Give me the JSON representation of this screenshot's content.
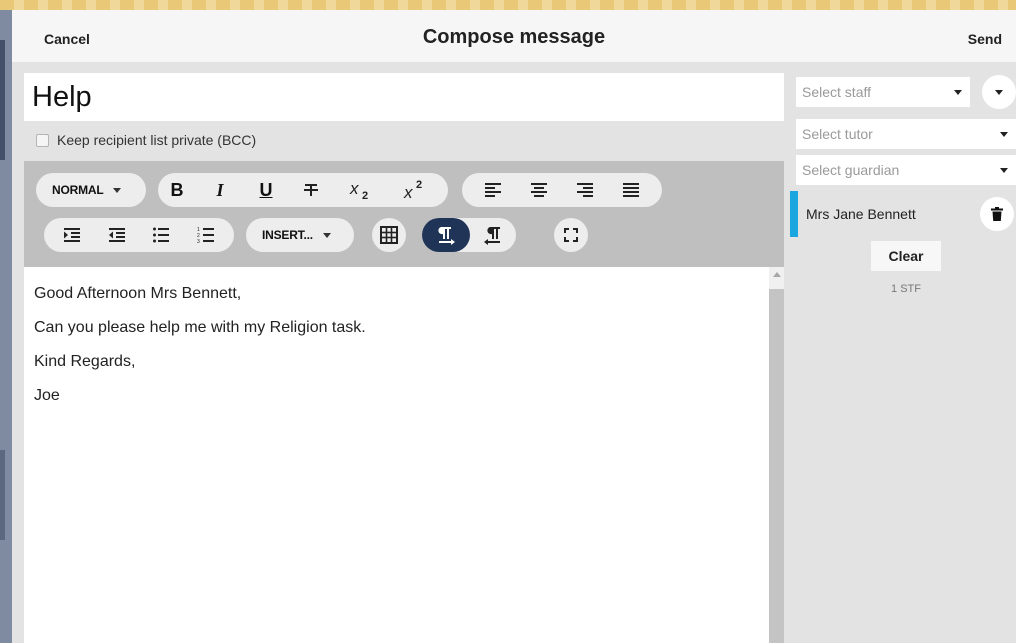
{
  "header": {
    "cancel_label": "Cancel",
    "title": "Compose message",
    "send_label": "Send"
  },
  "subject": {
    "value": "Help"
  },
  "bcc": {
    "label": "Keep recipient list private (BCC)",
    "checked": false
  },
  "toolbar": {
    "format_dropdown": "NORMAL",
    "insert_dropdown": "INSERT...",
    "buttons": {
      "bold": "B",
      "italic": "I",
      "underline": "U",
      "strikethrough": "strikethrough-icon",
      "subscript": "subscript-icon",
      "superscript": "superscript-icon",
      "align_left": "align-left-icon",
      "align_center": "align-center-icon",
      "align_right": "align-right-icon",
      "align_justify": "align-justify-icon",
      "indent": "indent-icon",
      "outdent": "outdent-icon",
      "bullet_list": "bullet-list-icon",
      "numbered_list": "numbered-list-icon",
      "table": "table-icon",
      "ltr": "ltr-paragraph-icon",
      "rtl": "rtl-paragraph-icon",
      "fullscreen": "fullscreen-icon"
    },
    "active_color": "#1f3456"
  },
  "body": {
    "paragraphs": [
      "Good Afternoon Mrs Bennett,",
      "Can you please help me with my Religion task.",
      "Kind Regards,",
      "Joe"
    ]
  },
  "recipients_panel": {
    "select_staff_placeholder": "Select staff",
    "select_tutor_placeholder": "Select tutor",
    "select_guardian_placeholder": "Select guardian",
    "recipients": [
      {
        "name": "Mrs Jane Bennett",
        "accent": "#1aa7df"
      }
    ],
    "clear_label": "Clear",
    "count_label": "1 STF"
  }
}
